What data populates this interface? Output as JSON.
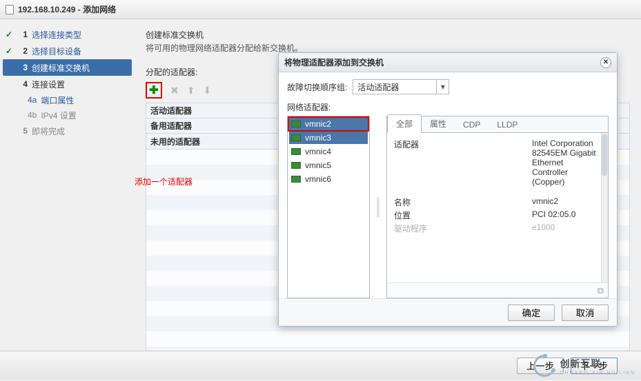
{
  "header": {
    "title": "192.168.10.249 - 添加网络"
  },
  "steps": {
    "s1": {
      "num": "1",
      "label": "选择连接类型"
    },
    "s2": {
      "num": "2",
      "label": "选择目标设备"
    },
    "s3": {
      "num": "3",
      "label": "创建标准交换机"
    },
    "s4": {
      "num": "4",
      "label": "连接设置"
    },
    "s4a": {
      "num": "4a",
      "label": "端口属性"
    },
    "s4b": {
      "num": "4b",
      "label": "IPv4 设置"
    },
    "s5": {
      "num": "5",
      "label": "即将完成"
    }
  },
  "helper": "添加一个适配器",
  "main": {
    "title": "创建标准交换机",
    "desc": "将可用的物理网络适配器分配给新交换机。",
    "section": "分配的适配器:",
    "groups": {
      "active": "活动适配器",
      "standby": "备用适配器",
      "unused": "未用的适配器"
    }
  },
  "dialog": {
    "title": "将物理适配器添加到交换机",
    "failoverLabel": "故障切换顺序组:",
    "failoverValue": "活动适配器",
    "netAdaptersLabel": "网络适配器:",
    "nics": {
      "n0": "vmnic2",
      "n1": "vmnic3",
      "n2": "vmnic4",
      "n3": "vmnic5",
      "n4": "vmnic6"
    },
    "tabs": {
      "all": "全部",
      "prop": "属性",
      "cdp": "CDP",
      "lldp": "LLDP"
    },
    "details": {
      "adapterKey": "适配器",
      "adapterVal": "Intel Corporation 82545EM Gigabit Ethernet Controller (Copper)",
      "nameKey": "名称",
      "nameVal": "vmnic2",
      "locKey": "位置",
      "locVal": "PCI 02:05.0",
      "drvKey": "驱动程序",
      "drvVal": "e1000"
    },
    "ok": "确定",
    "cancel": "取消"
  },
  "footer": {
    "prev": "上一步",
    "next": "下一步"
  },
  "brand": {
    "name": "创新互联",
    "sub": "CHUANG XIN HU LIAN"
  }
}
